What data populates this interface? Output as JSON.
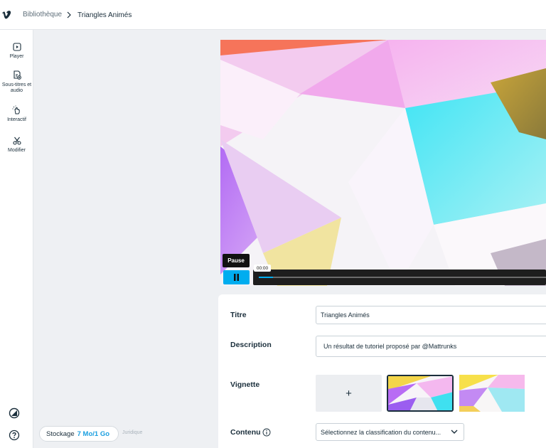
{
  "breadcrumb": {
    "library": "Bibliothèque",
    "current": "Triangles Animés"
  },
  "sidebar": {
    "items": [
      {
        "label": "Player",
        "icon": "play-square-icon"
      },
      {
        "label": "Sous-titres et audio",
        "icon": "captions-icon"
      },
      {
        "label": "Interactif",
        "icon": "pointer-click-icon"
      },
      {
        "label": "Modifier",
        "icon": "scissors-icon"
      }
    ],
    "bottom": [
      "theme-icon",
      "help-icon"
    ]
  },
  "storage": {
    "label": "Stockage",
    "value": "7 Mo/1 Go",
    "legal": "Juridique"
  },
  "player": {
    "pause_tooltip": "Pause",
    "time": "00:00",
    "progress": 0.05
  },
  "form": {
    "title_label": "Titre",
    "title_value": "Triangles Animés",
    "description_label": "Description",
    "description_value": "Un résultat de tutoriel proposé par @Mattrunks",
    "thumbnail_label": "Vignette",
    "add_symbol": "+",
    "content_label": "Contenu",
    "content_select": "Sélectionnez la classification du contenu..."
  },
  "colors": {
    "accent": "#00adef",
    "storage_value": "#1b9fe0"
  }
}
